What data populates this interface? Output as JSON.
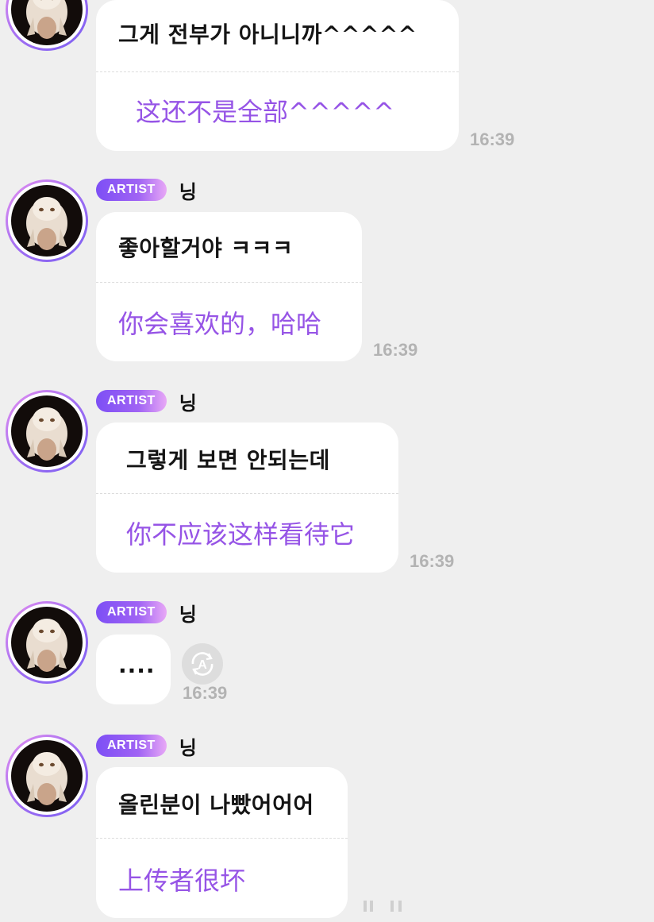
{
  "badge_label": "ARTIST",
  "artist_name": "닝",
  "messages": [
    {
      "original": "그게 전부가 아니니까^^^^^",
      "translation": "这还不是全部^^^^^",
      "time": "16:39"
    },
    {
      "original": "좋아할거야 ㅋㅋㅋ",
      "translation": "你会喜欢的，哈哈",
      "time": "16:39"
    },
    {
      "original": "그렇게 보면 안되는데",
      "translation": "你不应该这样看待它",
      "time": "16:39"
    },
    {
      "original": "....",
      "time": "16:39",
      "translate_icon": "translate-icon"
    },
    {
      "original": "올린분이 나빴어어어",
      "translation": "上传者很坏"
    }
  ],
  "colors": {
    "background": "#efefef",
    "bubble": "#ffffff",
    "translation_text": "#9654e6",
    "badge_start": "#7d4ff5",
    "badge_end": "#e8a8f6",
    "timestamp": "#b3b3b3",
    "avatar_ring": "#9c6cf2"
  }
}
